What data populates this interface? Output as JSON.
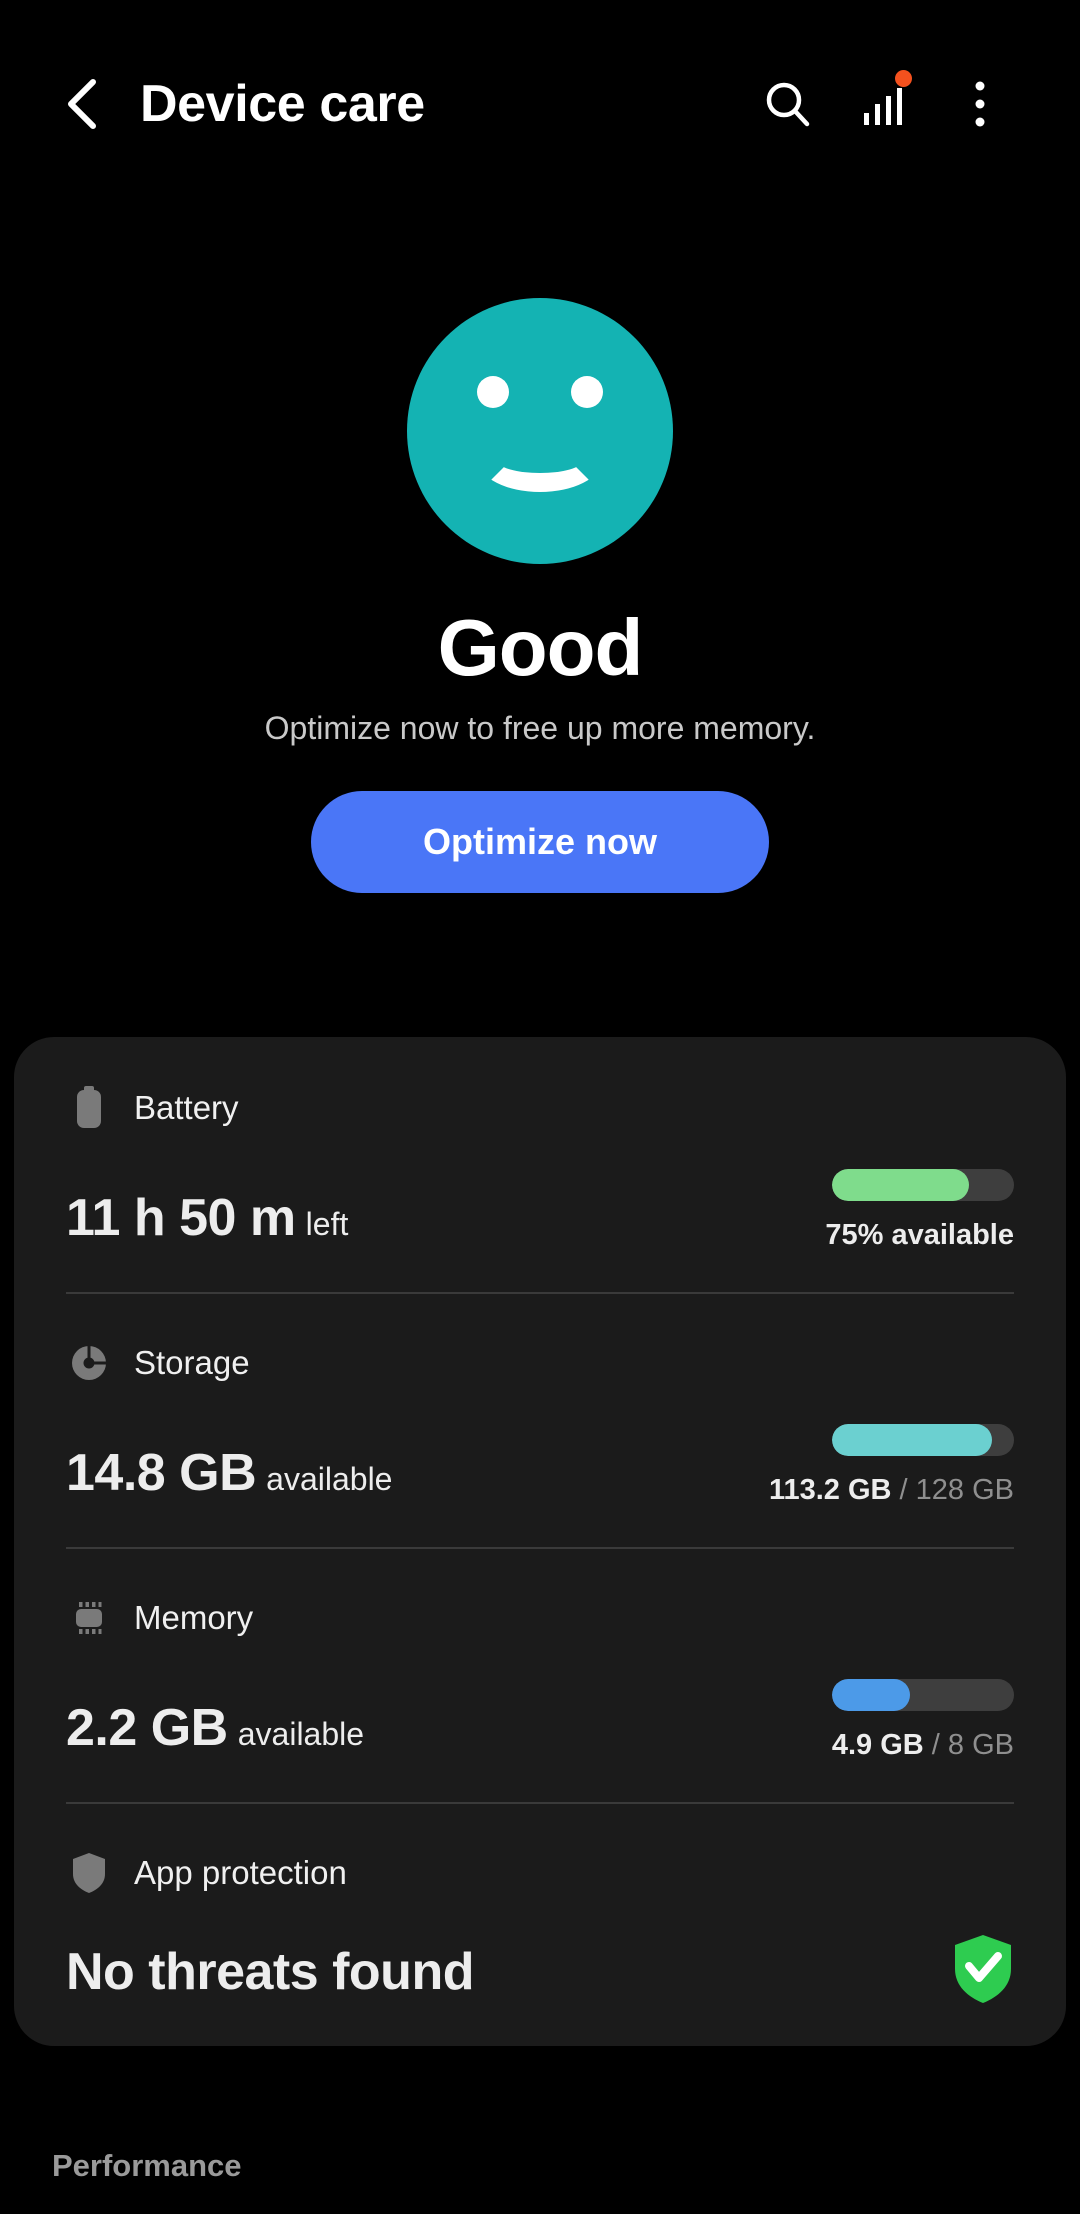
{
  "header": {
    "title": "Device care",
    "back_icon": "chevron-left-icon",
    "search_icon": "search-icon",
    "stats_icon": "bar-chart-icon",
    "more_icon": "overflow-menu-icon",
    "badge_color": "#F4511E"
  },
  "hero": {
    "face_icon": "smiley-face-icon",
    "face_color": "#14B3B3",
    "status": "Good",
    "subtitle": "Optimize now to free up more memory.",
    "optimize_label": "Optimize now",
    "optimize_color": "#4A76F7"
  },
  "summary": {
    "rows": [
      {
        "id": "battery",
        "icon": "battery-icon",
        "label": "Battery",
        "value": "11 h 50 m",
        "suffix": "left",
        "bar_percent": 75,
        "bar_color": "#7FDC8C",
        "caption_primary": "75% available",
        "caption_muted": ""
      },
      {
        "id": "storage",
        "icon": "pie-chart-icon",
        "label": "Storage",
        "value": "14.8 GB",
        "suffix": "available",
        "bar_percent": 88,
        "bar_color": "#6BD0D0",
        "caption_primary": "113.2 GB",
        "caption_muted": " / 128 GB"
      },
      {
        "id": "memory",
        "icon": "memory-chip-icon",
        "label": "Memory",
        "value": "2.2 GB",
        "suffix": "available",
        "bar_percent": 43,
        "bar_color": "#4C9AE8",
        "caption_primary": "4.9 GB",
        "caption_muted": " / 8 GB"
      },
      {
        "id": "app-protection",
        "icon": "shield-icon",
        "label": "App protection",
        "value": "No threats found",
        "suffix": "",
        "badge_icon": "shield-check-icon",
        "badge_color": "#2ECC50"
      }
    ]
  },
  "performance": {
    "section_label": "Performance"
  }
}
